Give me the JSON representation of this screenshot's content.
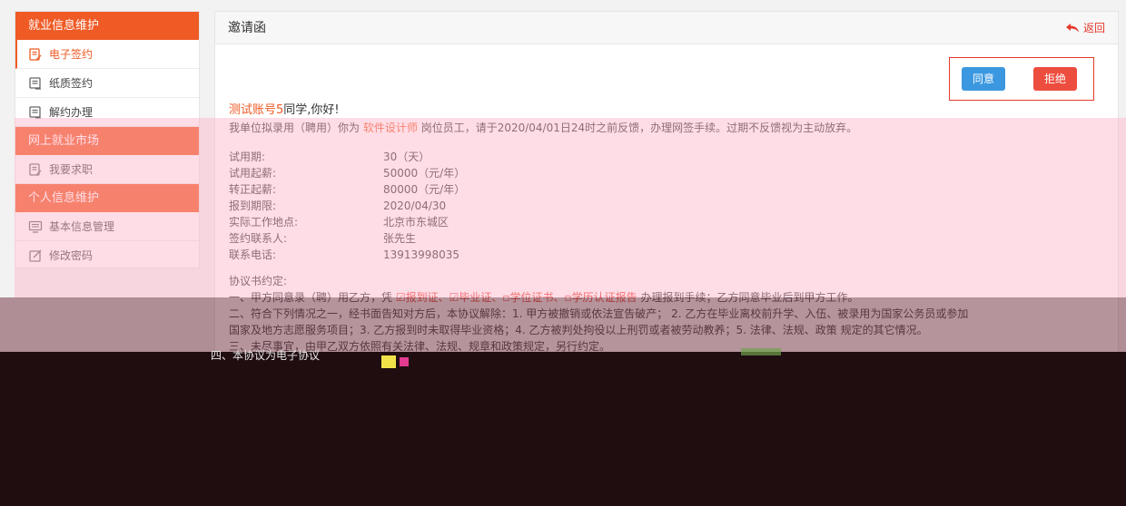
{
  "sidebar": {
    "sections": [
      {
        "title": "就业信息维护",
        "items": [
          {
            "label": "电子签约",
            "active": true
          },
          {
            "label": "纸质签约"
          },
          {
            "label": "解约办理"
          }
        ]
      },
      {
        "title": "网上就业市场",
        "items": [
          {
            "label": "我要求职"
          }
        ]
      },
      {
        "title": "个人信息维护",
        "items": [
          {
            "label": "基本信息管理"
          },
          {
            "label": "修改密码"
          }
        ]
      }
    ]
  },
  "panel": {
    "title": "邀请函",
    "back_label": "返回",
    "agree_label": "同意",
    "reject_label": "拒绝"
  },
  "letter": {
    "account_name": "测试账号5",
    "greeting_suffix": "同学,你好!",
    "intro_prefix": "我单位拟录用（聘用）你为",
    "job_title": "软件设计师",
    "intro_suffix": "岗位员工，请于2020/04/01日24时之前反馈，办理网签手续。过期不反馈视为主动放弃。",
    "details": [
      {
        "label": "试用期:",
        "value": "30（天）"
      },
      {
        "label": "试用起薪:",
        "value": "50000（元/年）"
      },
      {
        "label": "转正起薪:",
        "value": "80000（元/年）"
      },
      {
        "label": "报到期限:",
        "value": "2020/04/30"
      },
      {
        "label": "实际工作地点:",
        "value": "北京市东城区"
      },
      {
        "label": "签约联系人:",
        "value": "张先生"
      },
      {
        "label": "联系电话:",
        "value": "13913998035"
      }
    ],
    "agreement_title": "协议书约定:",
    "clause1_prefix": "一、甲方同意录（聘）用乙方，凭",
    "clause1_docs": "☑报到证、☑毕业证、▫学位证书、▫学历认证报告",
    "clause1_suffix": "办理报到手续；乙方同意毕业后到甲方工作。",
    "clause2": "二、符合下列情况之一，经书面告知对方后，本协议解除：1. 甲方被撤销或依法宣告破产；  2. 乙方在毕业离校前升学、入伍、被录用为国家公务员或参加",
    "clause2_cont": "国家及地方志愿服务项目；3. 乙方报到时未取得毕业资格；4. 乙方被判处拘役以上刑罚或者被劳动教养；5. 法律、法规、政策 规定的其它情况。",
    "clause3": "三、未尽事宜，由甲乙双方依照有关法律、法规、规章和政策规定，另行约定。",
    "clause4_partial": "四、本协议为电子协议"
  }
}
